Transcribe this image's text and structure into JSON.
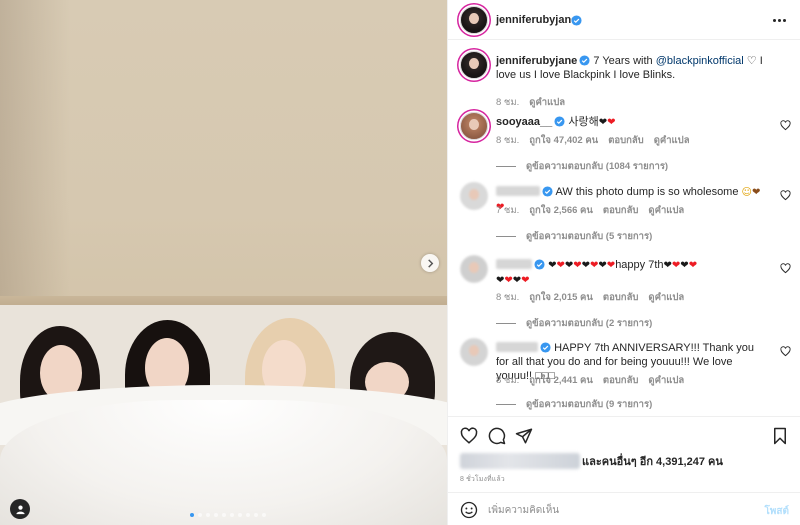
{
  "post": {
    "username": "jenniferubyjane",
    "carousel_total": 10,
    "carousel_current": 1
  },
  "caption": {
    "username": "jenniferubyjane",
    "text_before": "7 Years with ",
    "mention": "@blackpinkofficial",
    "text_after": " ♡ I love us I love Blackpink I love Blinks.",
    "time": "8 ชม.",
    "translate": "ดูคำแปล"
  },
  "comments": [
    {
      "username": "sooyaaa__",
      "text": "사랑해",
      "emoji": [
        "❤",
        "❤"
      ],
      "time": "8 ชม.",
      "likes": "ถูกใจ 47,402 คน",
      "reply": "ตอบกลับ",
      "translate": "ดูคำแปล",
      "view_replies": "ดูข้อความตอบกลับ (1084 รายการ)"
    },
    {
      "username": "",
      "text": "AW this photo dump is so wholesome",
      "emoji": [
        "☺",
        "❤",
        "❤"
      ],
      "time": "7 ชม.",
      "likes": "ถูกใจ 2,566 คน",
      "reply": "ตอบกลับ",
      "translate": "ดูคำแปล",
      "view_replies": "ดูข้อความตอบกลับ (5 รายการ)"
    },
    {
      "username": "",
      "text": "happy 7th",
      "emoji": [
        "❤",
        "❤",
        "❤",
        "❤",
        "❤",
        "❤",
        "❤",
        "❤"
      ],
      "emoji_tail": [
        "❤",
        "❤",
        "❤",
        "❤",
        "❤",
        "❤",
        "❤",
        "❤"
      ],
      "time": "8 ชม.",
      "likes": "ถูกใจ 2,015 คน",
      "reply": "ตอบกลับ",
      "translate": "ดูคำแปล",
      "view_replies": "ดูข้อความตอบกลับ (2 รายการ)"
    },
    {
      "username": "",
      "text": "HAPPY 7th ANNIVERSARY!!! Thank you for all that you do and for being youuu!!! We love youuu!! □□□",
      "time": "8 ชม.",
      "likes": "ถูกใจ 2,441 คน",
      "reply": "ตอบกลับ",
      "translate": "ดูคำแปล",
      "view_replies": "ดูข้อความตอบกลับ (9 รายการ)"
    }
  ],
  "likes_text": "และคนอื่นๆ อีก 4,391,247 คน",
  "time_ago": "8 ชั่วโมงที่แล้ว",
  "add_comment": {
    "placeholder": "เพิ่มความคิดเห็น",
    "post_label": "โพสต์"
  },
  "colors": {
    "link": "#00376b",
    "verified": "#3897f0",
    "muted": "#8e8e8e",
    "post_button_disabled": "#b2dffc"
  },
  "icons": {
    "like": "heart-outline-icon",
    "comment": "speech-bubble-icon",
    "share": "paper-plane-icon",
    "save": "bookmark-icon",
    "emoji": "smiley-icon",
    "more": "ellipsis-icon",
    "next": "chevron-right-icon",
    "tag": "user-tag-icon"
  }
}
